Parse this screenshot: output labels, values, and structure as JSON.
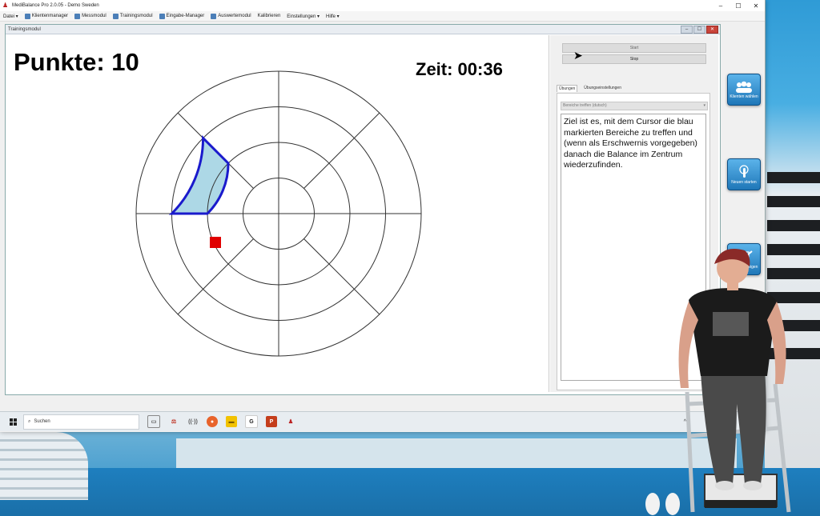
{
  "window": {
    "title": "MediBalance Pro   2.0.05 - Demo Sweden",
    "controls": [
      "–",
      "☐",
      "✕"
    ]
  },
  "menu": {
    "items": [
      {
        "label": "Datei ▾",
        "icon": false
      },
      {
        "label": "Klientenmanager",
        "icon": true
      },
      {
        "label": "Messmodul",
        "icon": true
      },
      {
        "label": "Trainingsmodul",
        "icon": true
      },
      {
        "label": "Eingabe-Manager",
        "icon": true
      },
      {
        "label": "Auswertemodul",
        "icon": true
      },
      {
        "label": "Kalibrieren",
        "icon": false
      },
      {
        "label": "Einstellungen ▾",
        "icon": false
      },
      {
        "label": "Hilfe ▾",
        "icon": false
      }
    ]
  },
  "inner": {
    "title": "Trainingsmodul"
  },
  "game": {
    "score": "Punkte: 10",
    "time": "Zeit: 00:36",
    "rings": 4,
    "sectors": 8,
    "highlight_color": "#1a1acc",
    "highlight_fill": "#add8e6",
    "marker_color": "#e00000"
  },
  "side": {
    "start_label": "Start",
    "stop_label": "Stop",
    "tab_exercises": "Übungen",
    "tab_settings": "Übungseinstellungen",
    "exercise_select": "Bereiche treffen (dutsch)",
    "description": "Ziel ist es, mit dem Cursor die blau markierten Bereiche zu treffen und (wenn als Erschwernis vorgegeben) danach die Balance im Zentrum wiederzufinden."
  },
  "floating_buttons": [
    {
      "label": "Klienten wählen",
      "icon": "people-icon"
    },
    {
      "label": "Neuen starten",
      "icon": "hand-touch-icon"
    },
    {
      "label": "Werte anzeigen",
      "icon": "chart-edit-icon"
    }
  ],
  "taskbar": {
    "search_placeholder": "Suchen",
    "tray": "^"
  },
  "colors": {
    "accent": "#1f77b8",
    "floor": "#1e7fbf"
  }
}
